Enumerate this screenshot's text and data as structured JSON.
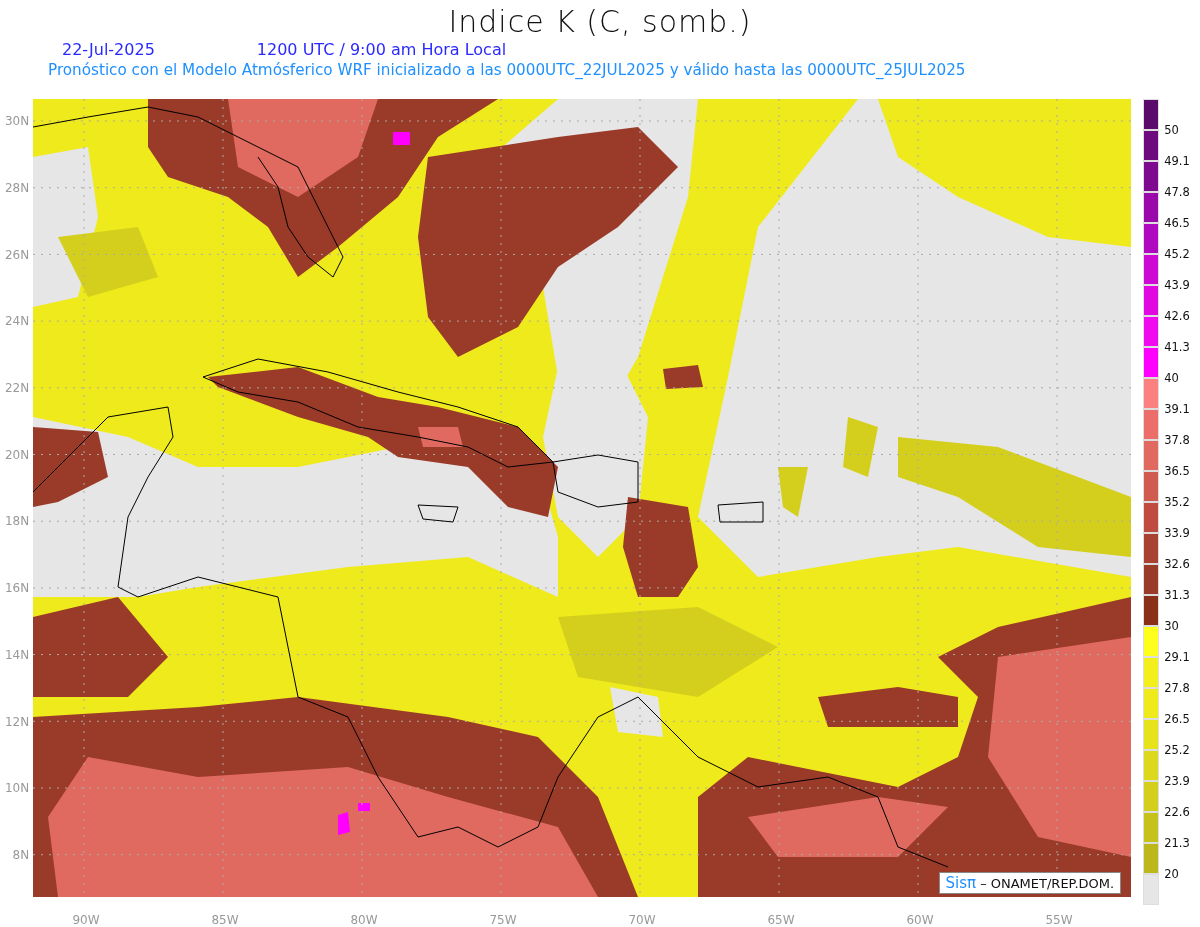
{
  "title": "Indice K (C, somb.)",
  "header": {
    "date": "22-Jul-2025",
    "time": "1200 UTC / 9:00 am Hora Local",
    "description": "Pronóstico con el Modelo Atmósferico WRF inicializado a las 0000UTC_22JUL2025 y válido hasta las  0000UTC_25JUL2025"
  },
  "map": {
    "lat_ticks": [
      "30N",
      "28N",
      "26N",
      "24N",
      "22N",
      "20N",
      "18N",
      "16N",
      "14N",
      "12N",
      "10N",
      "8N"
    ],
    "lon_ticks": [
      "90W",
      "85W",
      "80W",
      "75W",
      "70W",
      "65W",
      "60W",
      "55W"
    ],
    "credit": {
      "brand": "Sisπ",
      "text": "– ONAMET/REP.DOM."
    }
  },
  "colorbar": {
    "boxes": [
      {
        "color": "#5a0a6a"
      },
      {
        "color": "#6c0a7e"
      },
      {
        "color": "#7e0a90"
      },
      {
        "color": "#9a0aaa"
      },
      {
        "color": "#b00ac0"
      },
      {
        "color": "#cc0ad4"
      },
      {
        "color": "#e00ae0"
      },
      {
        "color": "#f00af0"
      },
      {
        "color": "#ff00ff"
      },
      {
        "color": "#fb8080"
      },
      {
        "color": "#ec6e6a"
      },
      {
        "color": "#e06a60"
      },
      {
        "color": "#d05c50"
      },
      {
        "color": "#c04c40"
      },
      {
        "color": "#aa4232"
      },
      {
        "color": "#9a3a28"
      },
      {
        "color": "#8a3018"
      },
      {
        "color": "#ffff1e"
      },
      {
        "color": "#f2ef1c"
      },
      {
        "color": "#eeea1c"
      },
      {
        "color": "#e6e31c"
      },
      {
        "color": "#dcd81c"
      },
      {
        "color": "#d4cf1c"
      },
      {
        "color": "#c6c21c"
      },
      {
        "color": "#bcb81c"
      },
      {
        "color": "#e6e6e6"
      }
    ],
    "labels": [
      "50",
      "49.1",
      "47.8",
      "46.5",
      "45.2",
      "43.9",
      "42.6",
      "41.3",
      "40",
      "39.1",
      "37.8",
      "36.5",
      "35.2",
      "33.9",
      "32.6",
      "31.3",
      "30",
      "29.1",
      "27.8",
      "26.5",
      "25.2",
      "23.9",
      "22.6",
      "21.3",
      "20"
    ]
  }
}
